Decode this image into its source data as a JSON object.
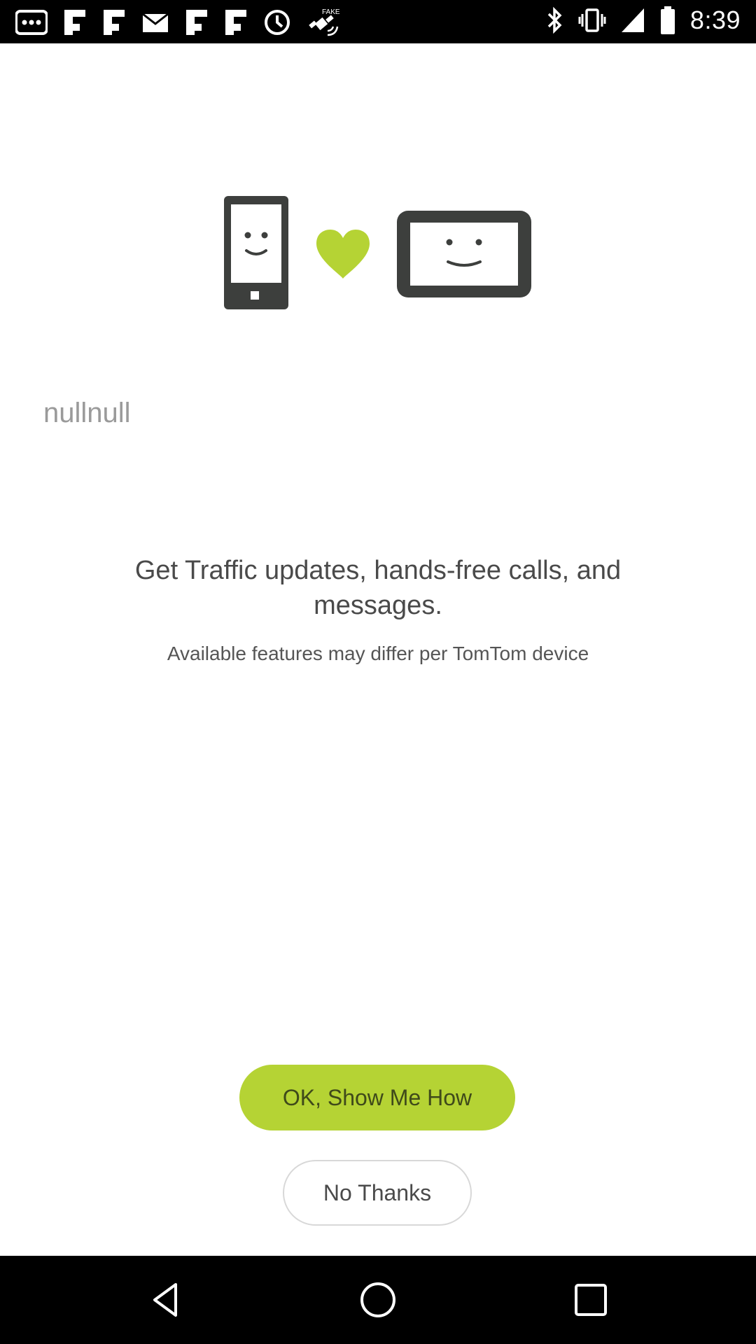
{
  "status_bar": {
    "time": "8:39",
    "left_icons": [
      "more-icon",
      "flipboard-icon",
      "flipboard-icon",
      "mail-icon",
      "flipboard-icon",
      "flipboard-icon",
      "data-saver-icon",
      "fake-gps-icon"
    ],
    "fake_gps_label": "FAKE",
    "right_icons": [
      "bluetooth-icon",
      "vibrate-icon",
      "signal-icon",
      "battery-icon"
    ]
  },
  "illustration": {
    "phone_icon": "smiling-phone-icon",
    "heart_icon": "heart-icon",
    "device_icon": "smiling-navigation-device-icon",
    "heart_color": "#b5d334",
    "device_color": "#3d3f3d"
  },
  "content": {
    "null_label": "nullnull",
    "headline": "Get Traffic updates, hands-free calls, and messages.",
    "subline": "Available features may differ per TomTom device"
  },
  "actions": {
    "primary_label": "OK, Show Me How",
    "secondary_label": "No Thanks",
    "primary_color": "#b5d334"
  },
  "nav_bar": {
    "back_icon": "back-icon",
    "home_icon": "home-icon",
    "recents_icon": "recents-icon"
  }
}
